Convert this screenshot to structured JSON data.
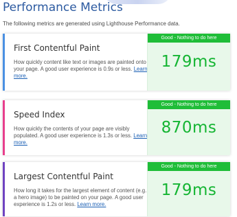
{
  "page": {
    "title": "Performance Metrics",
    "intro": "The following metrics are generated using Lighthouse Performance data."
  },
  "metrics": [
    {
      "name": "First Contentful Paint",
      "description": "How quickly content like text or images are painted onto your page. A good user experience is 0.9s or less.",
      "learn_more": "Learn more.",
      "status": "Good - Nothing to do here",
      "value": "179ms",
      "accent": "#4a90e2"
    },
    {
      "name": "Speed Index",
      "description": "How quickly the contents of your page are visibly populated. A good user experience is 1.3s or less.",
      "learn_more": "Learn more.",
      "status": "Good - Nothing to do here",
      "value": "870ms",
      "accent": "#e83e8c"
    },
    {
      "name": "Largest Contentful Paint",
      "description": "How long it takes for the largest element of content (e.g. a hero image) to be painted on your page. A good user experience is 1.2s or less.",
      "learn_more": "Learn more.",
      "status": "Good - Nothing to do here",
      "value": "179ms",
      "accent": "#6f42c1"
    }
  ],
  "colors": {
    "title": "#2c5aa0",
    "good_badge": "#1fbd38",
    "good_value": "#15b533",
    "good_panel": "#e8f8ea"
  }
}
